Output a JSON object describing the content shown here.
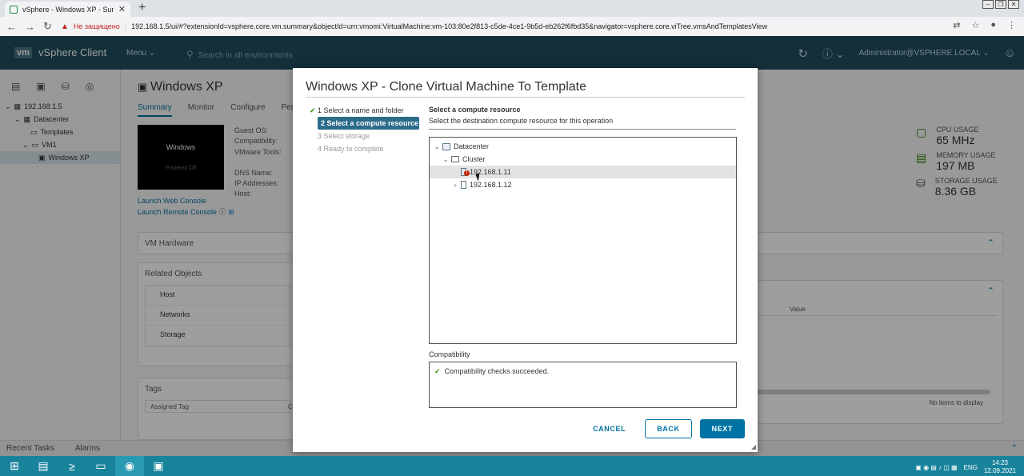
{
  "browser": {
    "tab_title": "vSphere - Windows XP - Summa",
    "not_secure": "Не защищено",
    "url": "192.168.1.5/ui/#?extensionId=vsphere.core.vm.summary&objectId=urn:vmomi:VirtualMachine:vm-103:80e2f813-c5de-4ce1-9b5d-eb262f6fbd35&navigator=vsphere.core.viTree.vmsAndTemplatesView"
  },
  "header": {
    "logo": "vm",
    "product": "vSphere Client",
    "menu": "Menu",
    "search_placeholder": "Search in all environments",
    "user": "Administrator@VSPHERE.LOCAL"
  },
  "tree": {
    "items": [
      {
        "label": "192.168.1.5"
      },
      {
        "label": "Datacenter"
      },
      {
        "label": "Templates"
      },
      {
        "label": "VM1"
      },
      {
        "label": "Windows XP"
      }
    ]
  },
  "vm": {
    "title": "Windows XP",
    "tabs": [
      "Summary",
      "Monitor",
      "Configure",
      "Per"
    ],
    "info_labels": [
      "Guest OS:",
      "Compatibility:",
      "VMware Tools:",
      "",
      "DNS Name:",
      "IP Addresses:",
      "Host:"
    ],
    "powered_off": "Powered Off",
    "thumb_text": "Windows",
    "launch_web": "Launch Web Console",
    "launch_remote": "Launch Remote Console",
    "vm_hardware": "VM Hardware",
    "related_objects": "Related Objects",
    "related_rows": [
      "Host",
      "Networks",
      "Storage"
    ],
    "tags": "Tags",
    "assigned_tag": "Assigned Tag",
    "cat_col": "Ca",
    "value_col": "Value",
    "no_items": "No items to display"
  },
  "resources": {
    "cpu_label": "CPU USAGE",
    "cpu_value": "65 MHz",
    "mem_label": "MEMORY USAGE",
    "mem_value": "197 MB",
    "storage_label": "STORAGE USAGE",
    "storage_value": "8.36 GB"
  },
  "statusbar": {
    "recent_tasks": "Recent Tasks",
    "alarms": "Alarms"
  },
  "taskbar": {
    "lang": "ENG",
    "time": "14:23",
    "date": "12.09.2021"
  },
  "dialog": {
    "title": "Windows XP - Clone Virtual Machine To Template",
    "steps": [
      {
        "label": "1 Select a name and folder",
        "state": "done"
      },
      {
        "label": "2 Select a compute resource",
        "state": "current"
      },
      {
        "label": "3 Select storage",
        "state": "pending"
      },
      {
        "label": "4 Ready to complete",
        "state": "pending"
      }
    ],
    "section_title": "Select a compute resource",
    "section_subtitle": "Select the destination compute resource for this operation",
    "tree": [
      {
        "label": "Datacenter"
      },
      {
        "label": "Cluster"
      },
      {
        "label": "192.168.1.11"
      },
      {
        "label": "192.168.1.12"
      }
    ],
    "compat_label": "Compatibility",
    "compat_message": "Compatibility checks succeeded.",
    "cancel": "CANCEL",
    "back": "BACK",
    "next": "NEXT"
  }
}
